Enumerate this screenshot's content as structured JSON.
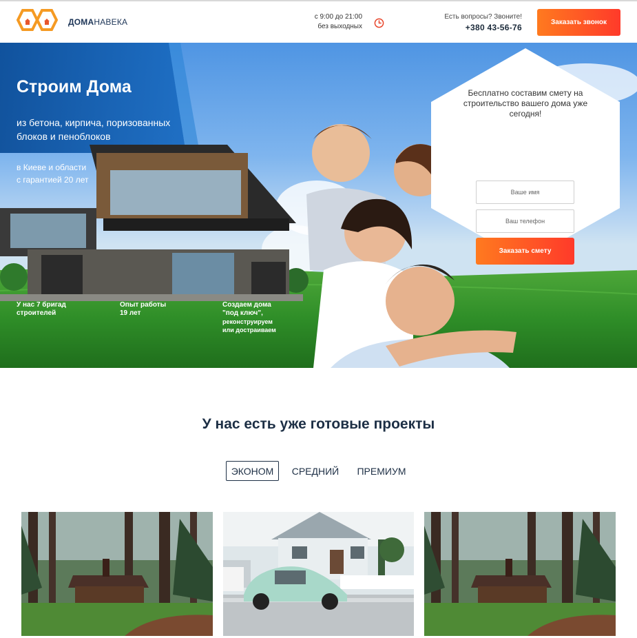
{
  "header": {
    "logo_bold": "ДОМА",
    "logo_light": "НАВЕКА",
    "hours_line1": "с 9:00 до 21:00",
    "hours_line2": "без выходных",
    "contact_question": "Есть вопросы? Звоните!",
    "phone": "+380 43-56-76",
    "call_button": "Заказать звонок"
  },
  "hero": {
    "title": "Строим Дома",
    "subtitle": "из бетона, кирпича, поризованных блоков и пеноблоков",
    "region": "в Киеве и области с гарантией 20 лет",
    "stats": [
      {
        "title": "У нас 7 бригад строителей",
        "note": ""
      },
      {
        "title": "Опыт работы 19 лет",
        "note": ""
      },
      {
        "title": "Создаем дома \"под ключ\",",
        "note": "реконструируем или достраиваем"
      }
    ]
  },
  "form": {
    "title": "Бесплатно составим смету на строительство вашего дома уже сегодня!",
    "name_placeholder": "Ваше имя",
    "phone_placeholder": "Ваш телефон",
    "submit": "Заказать смету"
  },
  "projects": {
    "title": "У нас есть уже готовые проекты",
    "tabs": [
      {
        "label": "ЭКОНОМ",
        "active": true
      },
      {
        "label": "СРЕДНИЙ",
        "active": false
      },
      {
        "label": "ПРЕМИУМ",
        "active": false
      }
    ]
  },
  "colors": {
    "accent_start": "#ff7a1f",
    "accent_end": "#ff3a2a",
    "navy": "#1d2f45",
    "hero_blue": "#1a5fb0"
  },
  "icons": [
    "logo-hexagon-icon",
    "clock-icon"
  ]
}
